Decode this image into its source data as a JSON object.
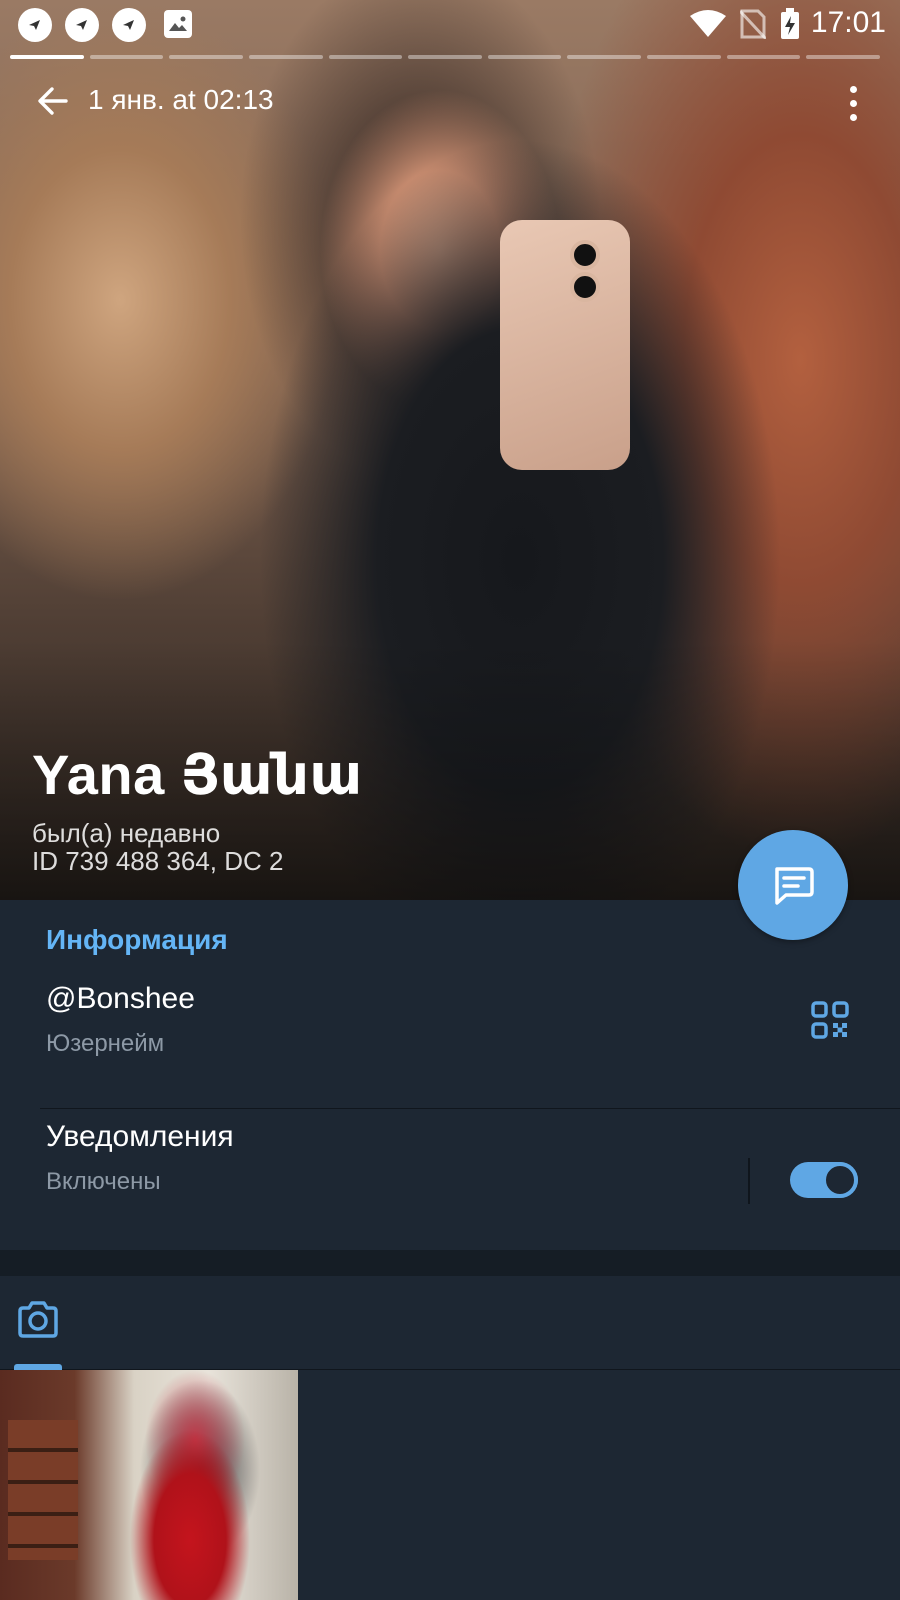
{
  "status_bar": {
    "time": "17:01"
  },
  "story": {
    "segments": 11,
    "active_segment": 1,
    "date": "1 янв. at 02:13"
  },
  "profile": {
    "name": "Yana Յանա",
    "last_seen": "был(а) недавно",
    "id_line": "ID 739 488 364, DC 2"
  },
  "info": {
    "section_title": "Информация",
    "username": "@Bonshee",
    "username_label": "Юзернейм",
    "notifications_title": "Уведомления",
    "notifications_state": "Включены",
    "notifications_on": true
  },
  "colors": {
    "accent": "#5fa7e4",
    "section_title": "#64b5f6",
    "background": "#1d2733"
  }
}
